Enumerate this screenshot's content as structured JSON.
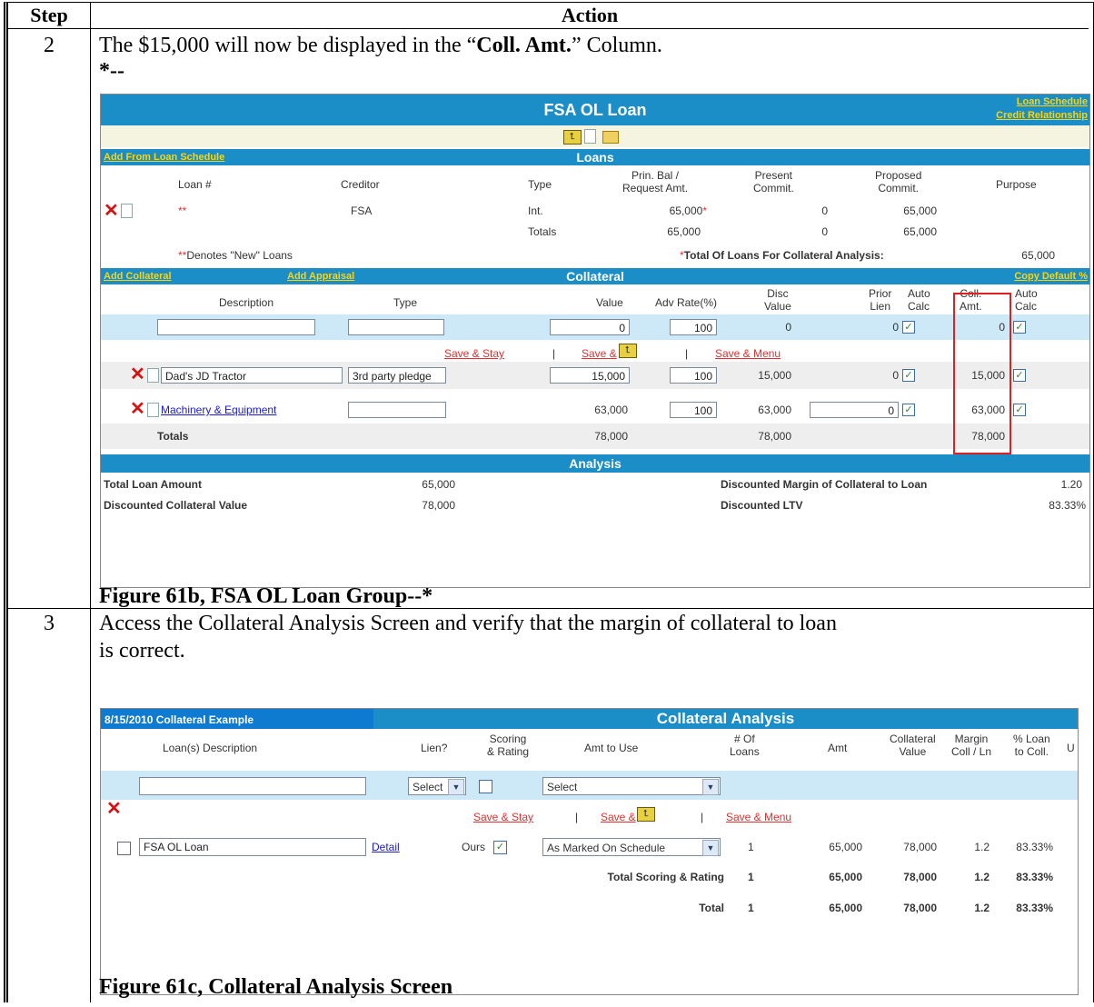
{
  "table": {
    "header_step": "Step",
    "header_action": "Action",
    "rows": [
      {
        "step": "2",
        "text_prefix": "The $15,000 will now be displayed in the “",
        "text_bold": "Coll. Amt.",
        "text_suffix": "” Column.",
        "marker_start": "*--",
        "caption": "Figure 61b, FSA OL Loan Group--*"
      },
      {
        "step": "3",
        "text_line1": "Access the Collateral Analysis Screen and verify that the margin of collateral to loan",
        "text_line2": "is correct.",
        "caption": "Figure 61c, Collateral Analysis Screen"
      }
    ]
  },
  "shot1": {
    "title": "FSA OL Loan",
    "link_loan_schedule": "Loan Schedule",
    "link_credit_relationship": "Credit Relationship",
    "loans_bar": {
      "add_link": "Add From Loan Schedule",
      "title": "Loans"
    },
    "loans_headers": {
      "loan_no": "Loan #",
      "creditor": "Creditor",
      "type": "Type",
      "prin_bal_1": "Prin. Bal /",
      "prin_bal_2": "Request Amt.",
      "present_1": "Present",
      "present_2": "Commit.",
      "proposed_1": "Proposed",
      "proposed_2": "Commit.",
      "purpose": "Purpose"
    },
    "loan_row": {
      "loan_no": "**",
      "creditor": "FSA",
      "type": "Int.",
      "prin_bal": "65,000",
      "star": "*",
      "present": "0",
      "proposed": "65,000"
    },
    "loan_totals": {
      "label": "Totals",
      "prin_bal": "65,000",
      "present": "0",
      "proposed": "65,000"
    },
    "new_loans_note": "Denotes \"New\" Loans",
    "new_loans_stars": "**",
    "total_loans_label": "Total Of Loans For Collateral Analysis:",
    "total_loans_star": "*",
    "total_loans_value": "65,000",
    "collateral_bar": {
      "add_collateral": "Add Collateral",
      "add_appraisal": "Add Appraisal",
      "title": "Collateral",
      "copy_default": "Copy Default %"
    },
    "coll_headers": {
      "description": "Description",
      "type": "Type",
      "value": "Value",
      "adv_rate": "Adv Rate(%)",
      "disc_1": "Disc",
      "disc_2": "Value",
      "prior_1": "Prior",
      "prior_2": "Lien",
      "auto_1": "Auto",
      "auto_2": "Calc",
      "coll_1": "Coll.",
      "coll_2": "Amt.",
      "auto2_1": "Auto",
      "auto2_2": "Calc"
    },
    "new_row": {
      "value": "0",
      "adv_rate": "100",
      "disc": "0",
      "prior": "0",
      "coll": "0"
    },
    "save_stay": "Save & Stay",
    "save_and": "Save &",
    "save_menu": "Save & Menu",
    "sep": "|",
    "coll_rows": [
      {
        "description": "Dad's JD Tractor",
        "type": "3rd party pledge",
        "value": "15,000",
        "adv_rate": "100",
        "disc": "15,000",
        "prior": "0",
        "coll": "15,000"
      },
      {
        "description": "Machinery & Equipment",
        "type": "",
        "value": "63,000",
        "adv_rate": "100",
        "disc": "63,000",
        "prior": "0",
        "coll": "63,000"
      }
    ],
    "coll_totals": {
      "label": "Totals",
      "value": "78,000",
      "disc": "78,000",
      "coll": "78,000"
    },
    "analysis": {
      "title": "Analysis",
      "total_loan_label": "Total Loan Amount",
      "total_loan_value": "65,000",
      "disc_coll_label": "Discounted Collateral Value",
      "disc_coll_value": "78,000",
      "margin_label": "Discounted Margin of Collateral to Loan",
      "margin_value": "1.20",
      "ltv_label": "Discounted LTV",
      "ltv_value": "83.33%"
    }
  },
  "shot2": {
    "date_title": "8/15/2010 Collateral Example",
    "title": "Collateral Analysis",
    "headers": {
      "loan_desc": "Loan(s) Description",
      "lien": "Lien?",
      "scoring_1": "Scoring",
      "scoring_2": "& Rating",
      "amt_to_use": "Amt to Use",
      "num_1": "# Of",
      "num_2": "Loans",
      "amt": "Amt",
      "coll_1": "Collateral",
      "coll_2": "Value",
      "margin_1": "Margin",
      "margin_2": "Coll / Ln",
      "pct_1": "% Loan",
      "pct_2": "to Coll.",
      "cut": "U"
    },
    "select_lien": "Select",
    "select_amt": "Select",
    "save_stay": "Save & Stay",
    "save_and": "Save &",
    "save_menu": "Save & Menu",
    "sep": "|",
    "row": {
      "description": "FSA OL Loan",
      "detail": "Detail",
      "lien": "Ours",
      "amt_to_use": "As Marked On Schedule",
      "num_loans": "1",
      "amt": "65,000",
      "coll_value": "78,000",
      "margin": "1.2",
      "pct": "83.33%"
    },
    "total_scoring": {
      "label": "Total Scoring & Rating",
      "num_loans": "1",
      "amt": "65,000",
      "coll_value": "78,000",
      "margin": "1.2",
      "pct": "83.33%"
    },
    "total": {
      "label": "Total",
      "num_loans": "1",
      "amt": "65,000",
      "coll_value": "78,000",
      "margin": "1.2",
      "pct": "83.33%"
    }
  }
}
